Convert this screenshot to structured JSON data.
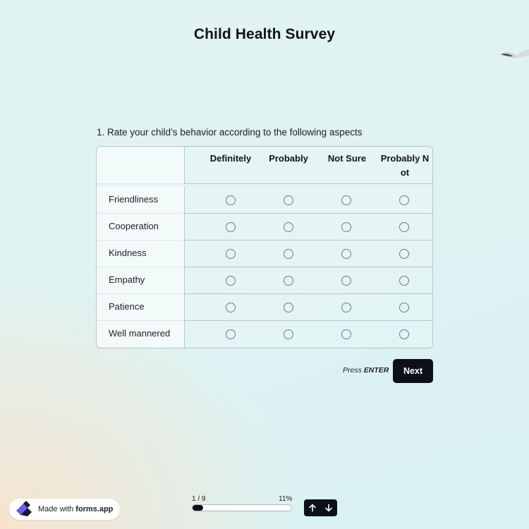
{
  "survey": {
    "title": "Child Health Survey"
  },
  "question": {
    "text": "1.  Rate your child’s behavior according to the following aspects",
    "columns": [
      "Definitely",
      "Probably",
      "Not Sure",
      "Probably Not"
    ],
    "rows": [
      "Friendliness",
      "Cooperation",
      "Kindness",
      "Empathy",
      "Patience",
      "Well mannered"
    ]
  },
  "actions": {
    "press_prefix": "Press ",
    "press_key": "ENTER",
    "next_label": "Next"
  },
  "footer": {
    "badge_prefix": "Made with ",
    "badge_brand": "forms.app",
    "progress_counter": "1 / 9",
    "progress_percent_label": "11%",
    "progress_fraction": 0.11
  },
  "colors": {
    "primary_dark": "#0d0f1a",
    "logo_purple": "#6b5cf6",
    "background_teal": "#dff3f2",
    "background_peach": "#f6e4cf"
  },
  "icons": {
    "nav_up": "arrow-up-icon",
    "nav_down": "arrow-down-icon",
    "brand": "forms-app-logo-icon",
    "decoration": "bird-icon"
  }
}
